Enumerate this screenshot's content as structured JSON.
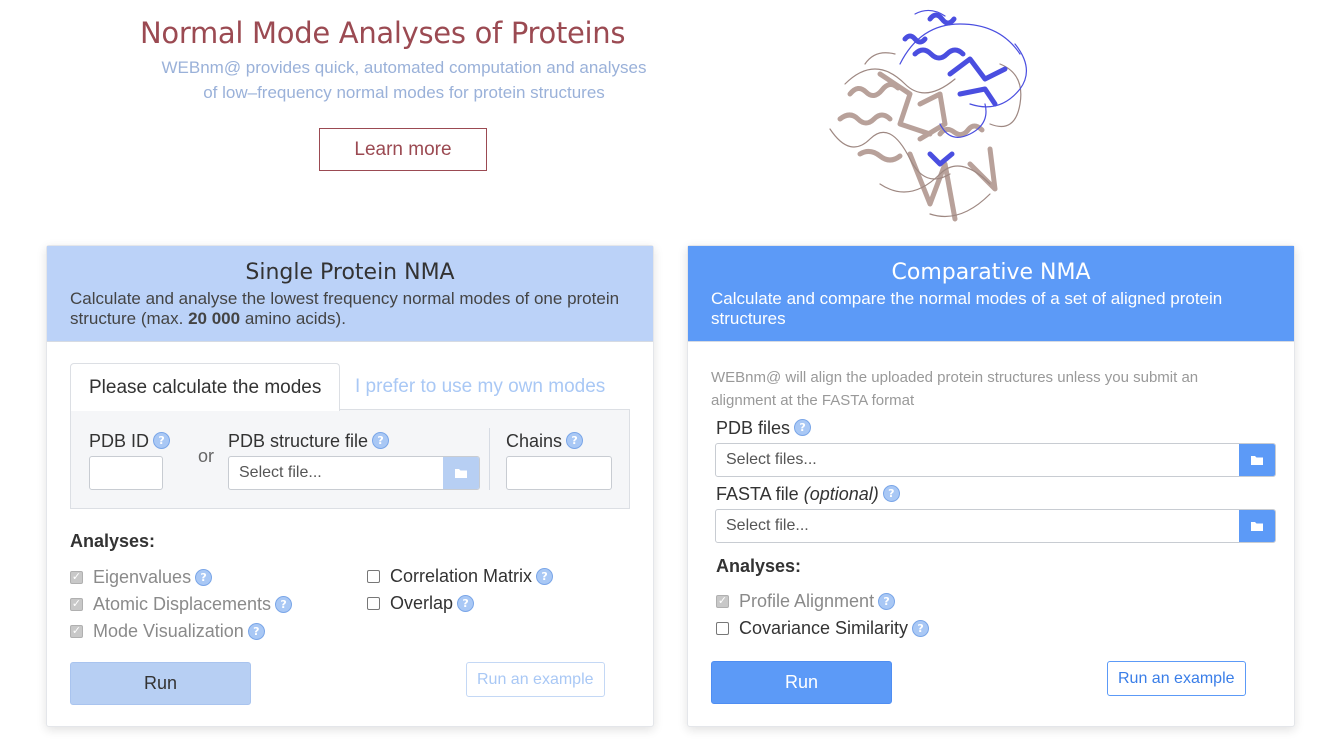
{
  "hero": {
    "title": "Normal Mode Analyses of Proteins",
    "subtitle_line1": "WEBnm@ provides quick, automated computation and analyses",
    "subtitle_line2": "of low–frequency normal modes for protein structures",
    "learn_more": "Learn more"
  },
  "colors": {
    "accent_red": "#9b4a52",
    "light_blue": "#bbd2f8",
    "strong_blue": "#5c9af7",
    "protein_brown": "#b8a19a",
    "protein_blue": "#4a4ee0"
  },
  "single": {
    "title": "Single Protein NMA",
    "desc_prefix": "Calculate and analyse the lowest frequency normal modes of one protein structure (max. ",
    "desc_bold": "20 000",
    "desc_suffix": " amino acids).",
    "tab_active": "Please calculate the modes",
    "tab_inactive": "I prefer to use my own modes",
    "pdb_id_label": "PDB ID",
    "or_label": "or",
    "pdb_file_label": "PDB structure file",
    "file_placeholder": "Select file...",
    "chains_label": "Chains",
    "analyses_label": "Analyses:",
    "analyses": [
      {
        "label": "Eigenvalues",
        "checked": true,
        "disabled": true
      },
      {
        "label": "Atomic Displacements",
        "checked": true,
        "disabled": true
      },
      {
        "label": "Mode Visualization",
        "checked": true,
        "disabled": true
      },
      {
        "label": "Correlation Matrix",
        "checked": false,
        "disabled": false
      },
      {
        "label": "Overlap",
        "checked": false,
        "disabled": false
      }
    ],
    "run_label": "Run",
    "example_label": "Run an example"
  },
  "comparative": {
    "title": "Comparative NMA",
    "desc": "Calculate and compare the normal modes of a set of aligned protein structures",
    "hint": "WEBnm@ will align the uploaded protein structures unless you submit an alignment at the FASTA format",
    "pdb_files_label": "PDB files",
    "pdb_files_placeholder": "Select files...",
    "fasta_label": "FASTA file",
    "fasta_optional": "(optional)",
    "fasta_placeholder": "Select file...",
    "analyses_label": "Analyses:",
    "analyses": [
      {
        "label": "Profile Alignment",
        "checked": true,
        "disabled": true
      },
      {
        "label": "Covariance Similarity",
        "checked": false,
        "disabled": false
      }
    ],
    "run_label": "Run",
    "example_label": "Run an example"
  },
  "icons": {
    "help": "help-icon",
    "folder": "folder-icon",
    "protein": "protein-structure-image"
  }
}
